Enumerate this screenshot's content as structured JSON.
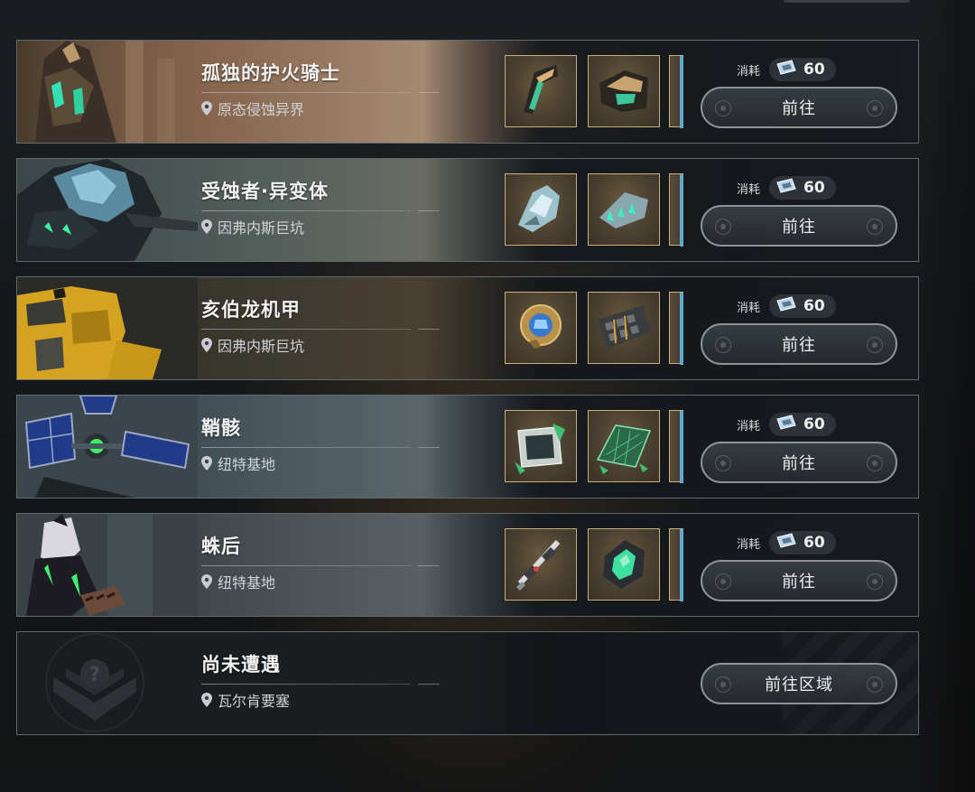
{
  "cost_label": "消耗",
  "go_label": "前往",
  "bosses": [
    {
      "name": "孤独的护火骑士",
      "location": "原态侵蚀异界",
      "cost": "60"
    },
    {
      "name": "受蚀者·异变体",
      "location": "因弗内斯巨坑",
      "cost": "60"
    },
    {
      "name": "亥伯龙机甲",
      "location": "因弗内斯巨坑",
      "cost": "60"
    },
    {
      "name": "鞘骸",
      "location": "纽特基地",
      "cost": "60"
    },
    {
      "name": "蛛后",
      "location": "纽特基地",
      "cost": "60"
    }
  ],
  "unknown": {
    "name": "尚未遭遇",
    "location": "瓦尔肯要塞",
    "button_label": "前往区域"
  },
  "colors": {
    "card_border": "#5e6a6c",
    "item_border": "#c9b07a",
    "button_border": "#8d9498"
  },
  "icons": [
    "map-pin-icon",
    "ticket-icon",
    "locked-boss-emblem-icon"
  ]
}
